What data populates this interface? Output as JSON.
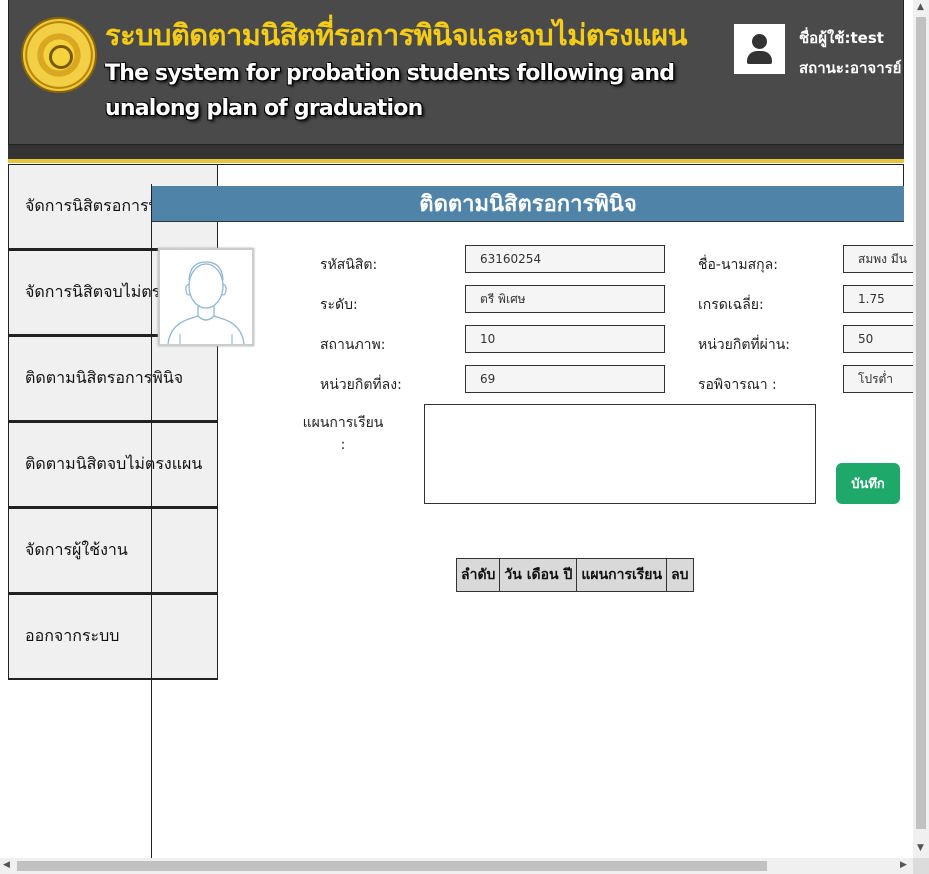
{
  "header": {
    "title_th": "ระบบติดตามนิสิตที่รอการพินิจและจบไม่ตรงแผน",
    "title_en": "The system for probation students following and unalong plan of graduation",
    "user_label": "ชื่อผู้ใช้:test",
    "status_label": "สถานะ:อาจารย์",
    "accent_color": "#e8c43a",
    "avatar_icon": "user-icon",
    "logo_icon": "university-seal-icon"
  },
  "sidebar": {
    "items": [
      {
        "label": "จัดการนิสิตรอการพินิจ"
      },
      {
        "label": "จัดการนิสิตจบไม่ตรงแผน"
      },
      {
        "label": "ติดตามนิสิตรอการพินิจ"
      },
      {
        "label": "ติดตามนิสิตจบไม่ตรงแผน"
      },
      {
        "label": "จัดการผู้ใช้งาน"
      },
      {
        "label": "ออกจากระบบ"
      }
    ]
  },
  "panel": {
    "title": "ติดตามนิสิตรอการพินิจ",
    "title_color": "#4f84a8",
    "photo_icon": "student-placeholder-icon",
    "fields": {
      "student_id": {
        "label": "รหัสนิสิต:",
        "value": "63160254"
      },
      "level": {
        "label": "ระดับ:",
        "value": "ตรี พิเศษ"
      },
      "status": {
        "label": "สถานภาพ:",
        "value": "10"
      },
      "credits_enrolled": {
        "label": "หน่วยกิตที่ลง:",
        "value": "69"
      },
      "name": {
        "label": "ชื่อ-นามสกุล:",
        "value": "สมพง มีน"
      },
      "gpa": {
        "label": "เกรดเฉลี่ย:",
        "value": "1.75"
      },
      "credits_passed": {
        "label": "หน่วยกิตที่ผ่าน:",
        "value": "50"
      },
      "consideration": {
        "label": "รอพิจารณา :",
        "value": "โปรต่ำ"
      }
    },
    "plan_label": "แผนการเรียน",
    "plan_colon": ":",
    "plan_value": "",
    "save_label": "บันทึก",
    "save_color": "#1ea96a",
    "table_headers": [
      "ลำดับ",
      "วัน เดือน ปี",
      "แผนการเรียน",
      "ลบ"
    ]
  }
}
